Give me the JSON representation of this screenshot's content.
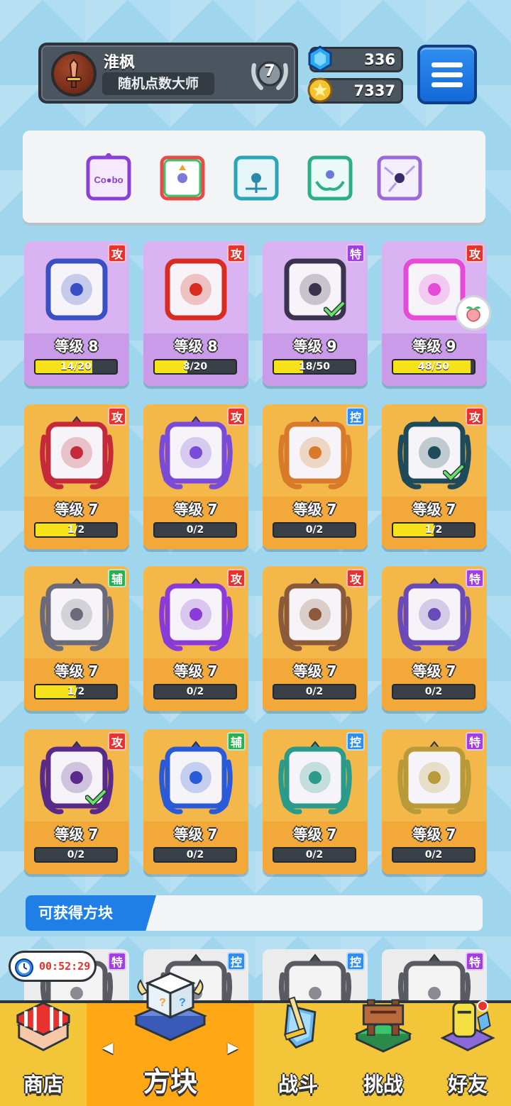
{
  "header": {
    "player_name": "淮枫",
    "player_title": "随机点数大师",
    "rank": "7",
    "gems": "336",
    "gold": "7337"
  },
  "colors": {
    "attack": "#e8322e",
    "special": "#a23fe0",
    "control": "#2e8ff0",
    "support": "#2cae52",
    "progress_fill": "#f6e21a"
  },
  "deck": [
    {
      "name": "combo-dice",
      "color": "#8a3fd6"
    },
    {
      "name": "rainbow-dice",
      "color": "#e84a4a"
    },
    {
      "name": "teal-dragon-dice",
      "color": "#2aa5b8"
    },
    {
      "name": "hands-dice",
      "color": "#2cae8a"
    },
    {
      "name": "crack-dice",
      "color": "#9a6ad8"
    }
  ],
  "cards": [
    {
      "tag": "攻",
      "tag_type": "attack",
      "level": "等级 8",
      "progress": "14/20",
      "fill": 0.7,
      "rarity": "purple",
      "dice_color": "#3b4fc4",
      "check": false
    },
    {
      "tag": "攻",
      "tag_type": "attack",
      "level": "等级 8",
      "progress": "8/20",
      "fill": 0.4,
      "rarity": "purple",
      "dice_color": "#d82c20",
      "check": false
    },
    {
      "tag": "特",
      "tag_type": "special",
      "level": "等级 9",
      "progress": "18/50",
      "fill": 0.36,
      "rarity": "purple",
      "dice_color": "#3a3350",
      "check": true
    },
    {
      "tag": "攻",
      "tag_type": "attack",
      "level": "等级 9",
      "progress": "48/50",
      "fill": 0.96,
      "rarity": "purple",
      "dice_color": "#e84ad8",
      "check": false
    },
    {
      "tag": "攻",
      "tag_type": "attack",
      "level": "等级 7",
      "progress": "1/2",
      "fill": 0.5,
      "rarity": "orange",
      "dice_color": "#c42a3a",
      "check": false
    },
    {
      "tag": "攻",
      "tag_type": "attack",
      "level": "等级 7",
      "progress": "0/2",
      "fill": 0,
      "rarity": "orange",
      "dice_color": "#7a4ad8",
      "check": false
    },
    {
      "tag": "控",
      "tag_type": "control",
      "level": "等级 7",
      "progress": "0/2",
      "fill": 0,
      "rarity": "orange",
      "dice_color": "#d87a2a",
      "check": false
    },
    {
      "tag": "攻",
      "tag_type": "attack",
      "level": "等级 7",
      "progress": "1/2",
      "fill": 0.5,
      "rarity": "orange",
      "dice_color": "#1e4a5a",
      "check": true
    },
    {
      "tag": "辅",
      "tag_type": "support",
      "level": "等级 7",
      "progress": "1/2",
      "fill": 0.5,
      "rarity": "orange",
      "dice_color": "#6a6a7a",
      "check": false
    },
    {
      "tag": "攻",
      "tag_type": "attack",
      "level": "等级 7",
      "progress": "0/2",
      "fill": 0,
      "rarity": "orange",
      "dice_color": "#8a3ad8",
      "check": false
    },
    {
      "tag": "攻",
      "tag_type": "attack",
      "level": "等级 7",
      "progress": "0/2",
      "fill": 0,
      "rarity": "orange",
      "dice_color": "#8a5a3a",
      "check": false
    },
    {
      "tag": "特",
      "tag_type": "special",
      "level": "等级 7",
      "progress": "0/2",
      "fill": 0,
      "rarity": "orange",
      "dice_color": "#6a4ab8",
      "check": false
    },
    {
      "tag": "攻",
      "tag_type": "attack",
      "level": "等级 7",
      "progress": "0/2",
      "fill": 0,
      "rarity": "orange",
      "dice_color": "#5a2a8a",
      "check": true
    },
    {
      "tag": "辅",
      "tag_type": "support",
      "level": "等级 7",
      "progress": "0/2",
      "fill": 0,
      "rarity": "orange",
      "dice_color": "#2a5ad8",
      "check": false
    },
    {
      "tag": "控",
      "tag_type": "control",
      "level": "等级 7",
      "progress": "0/2",
      "fill": 0,
      "rarity": "orange",
      "dice_color": "#2a9a8a",
      "check": false
    },
    {
      "tag": "特",
      "tag_type": "special",
      "level": "等级 7",
      "progress": "0/2",
      "fill": 0,
      "rarity": "orange",
      "dice_color": "#b89a3a",
      "check": false
    }
  ],
  "available": {
    "label": "可获得方块",
    "timer": "00:52:29",
    "tags": [
      "特",
      "控",
      "控",
      "特"
    ],
    "tag_types": [
      "special",
      "control",
      "control",
      "special"
    ]
  },
  "nav": {
    "shop": "商店",
    "dice": "方块",
    "battle": "战斗",
    "challenge": "挑战",
    "friends": "好友"
  }
}
